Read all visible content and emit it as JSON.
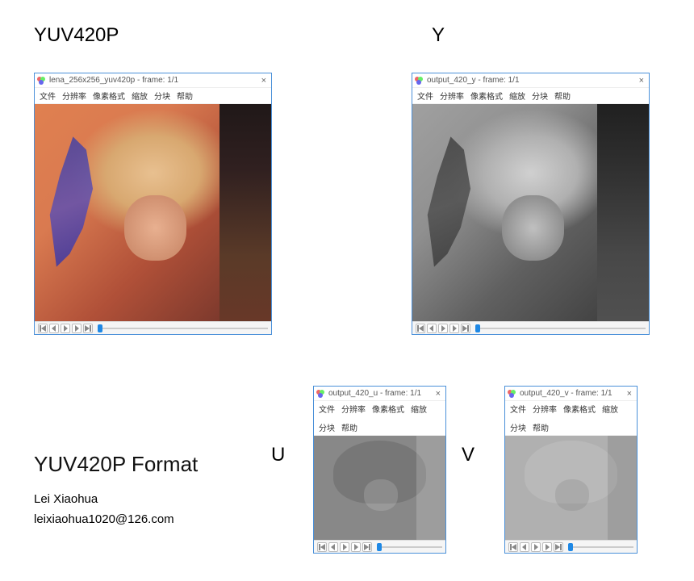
{
  "labels": {
    "yuv420p": "YUV420P",
    "y": "Y",
    "u": "U",
    "v": "V",
    "format_title": "YUV420P Format"
  },
  "credits": {
    "author": "Lei Xiaohua",
    "email": "leixiaohua1020@126.com"
  },
  "menus": {
    "full": [
      "文件",
      "分辨率",
      "像素格式",
      "缩放",
      "分块",
      "帮助"
    ],
    "small": [
      "文件",
      "分辨率",
      "像素格式",
      "缩放",
      "分块",
      "帮助"
    ]
  },
  "windows": {
    "main": {
      "icon": "app-icon",
      "title": "lena_256x256_yuv420p - frame: 1/1"
    },
    "y": {
      "icon": "app-icon",
      "title": "output_420_y - frame: 1/1"
    },
    "u": {
      "icon": "app-icon",
      "title": "output_420_u - frame: 1/1"
    },
    "v": {
      "icon": "app-icon",
      "title": "output_420_v - frame: 1/1"
    }
  },
  "close_glyph": "×"
}
